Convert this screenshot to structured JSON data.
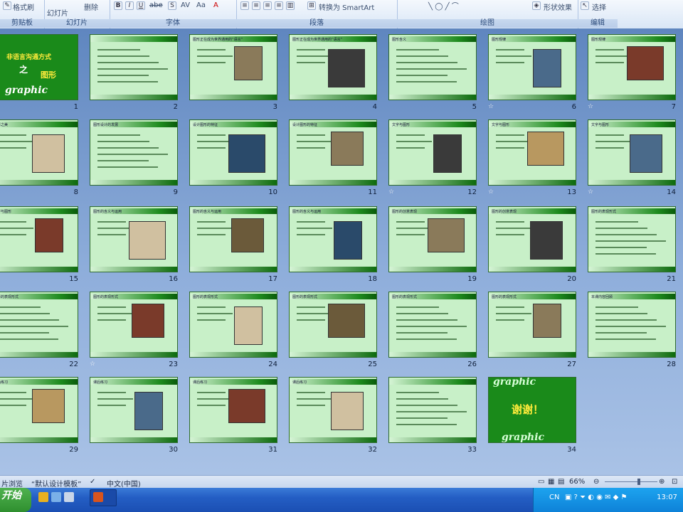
{
  "ribbon": {
    "groups": [
      {
        "caption": "剪贴板",
        "items": [
          "格式刷"
        ]
      },
      {
        "caption": "幻灯片",
        "items": [
          "幻灯片",
          "删除"
        ]
      },
      {
        "caption": "字体",
        "items": [
          "B",
          "I",
          "U",
          "abe",
          "S",
          "AV",
          "Aa",
          "A"
        ]
      },
      {
        "caption": "段落",
        "items": [
          "转换为 SmartArt"
        ]
      },
      {
        "caption": "绘图",
        "items": [
          "形状效果"
        ]
      },
      {
        "caption": "编辑",
        "items": [
          "选择"
        ]
      }
    ]
  },
  "slides": [
    {
      "n": "1",
      "kind": "title",
      "text1": "非语言沟通方式",
      "text2": "之",
      "text3": "图形",
      "text4": "graphic"
    },
    {
      "n": "2",
      "kind": "menu",
      "title": ""
    },
    {
      "n": "3",
      "kind": "pic",
      "title": "图形正在成为世界通用的“语言”"
    },
    {
      "n": "4",
      "kind": "pic",
      "title": "图形正在成为世界通用的“语言”"
    },
    {
      "n": "5",
      "kind": "text",
      "title": "图形含义"
    },
    {
      "n": "6",
      "kind": "pic",
      "title": "图形规律"
    },
    {
      "n": "7",
      "kind": "pic",
      "title": "图形规律"
    },
    {
      "n": "8",
      "kind": "pic",
      "title": "图形之美"
    },
    {
      "n": "9",
      "kind": "text",
      "title": "图形设计的发展"
    },
    {
      "n": "10",
      "kind": "pic",
      "title": "设计图形的特征"
    },
    {
      "n": "11",
      "kind": "pic",
      "title": "设计图形的特征"
    },
    {
      "n": "12",
      "kind": "pic",
      "title": "文字与图形"
    },
    {
      "n": "13",
      "kind": "pic",
      "title": "文字与图形"
    },
    {
      "n": "14",
      "kind": "pic",
      "title": "文字与图形"
    },
    {
      "n": "15",
      "kind": "pic",
      "title": "文字与图形"
    },
    {
      "n": "16",
      "kind": "pic",
      "title": "图形的含义与运用"
    },
    {
      "n": "17",
      "kind": "pic",
      "title": "图形的含义与运用"
    },
    {
      "n": "18",
      "kind": "pic",
      "title": "图形的含义与运用"
    },
    {
      "n": "19",
      "kind": "pic",
      "title": "图形的创意表现"
    },
    {
      "n": "20",
      "kind": "pic",
      "title": "图形的创意表现"
    },
    {
      "n": "21",
      "kind": "text",
      "title": "图形的表现形式"
    },
    {
      "n": "22",
      "kind": "text",
      "title": "图形的表现形式"
    },
    {
      "n": "23",
      "kind": "pic",
      "title": "图形的表现形式"
    },
    {
      "n": "24",
      "kind": "pic",
      "title": "图形的表现形式"
    },
    {
      "n": "25",
      "kind": "pic",
      "title": "图形的表现形式"
    },
    {
      "n": "26",
      "kind": "text",
      "title": "图形的表现形式"
    },
    {
      "n": "27",
      "kind": "pic",
      "title": "图形的表现形式"
    },
    {
      "n": "28",
      "kind": "text",
      "title": "本课内容回顾"
    },
    {
      "n": "29",
      "kind": "pic",
      "title": "课后练习"
    },
    {
      "n": "30",
      "kind": "pic",
      "title": "课后练习"
    },
    {
      "n": "31",
      "kind": "pic",
      "title": "课后练习"
    },
    {
      "n": "32",
      "kind": "pic",
      "title": "课后练习"
    },
    {
      "n": "33",
      "kind": "menu",
      "title": ""
    },
    {
      "n": "34",
      "kind": "end",
      "text1": "graphic",
      "text2": "谢谢！",
      "text3": "graphic"
    }
  ],
  "stars": [
    "6",
    "7",
    "12",
    "13",
    "14",
    "23"
  ],
  "status": {
    "view": "片浏览",
    "template": "“默认设计模板”",
    "lang": "中文(中国)",
    "zoom": "66%"
  },
  "taskbar": {
    "start": "开始",
    "clock": "13:07",
    "ime": "CN"
  }
}
